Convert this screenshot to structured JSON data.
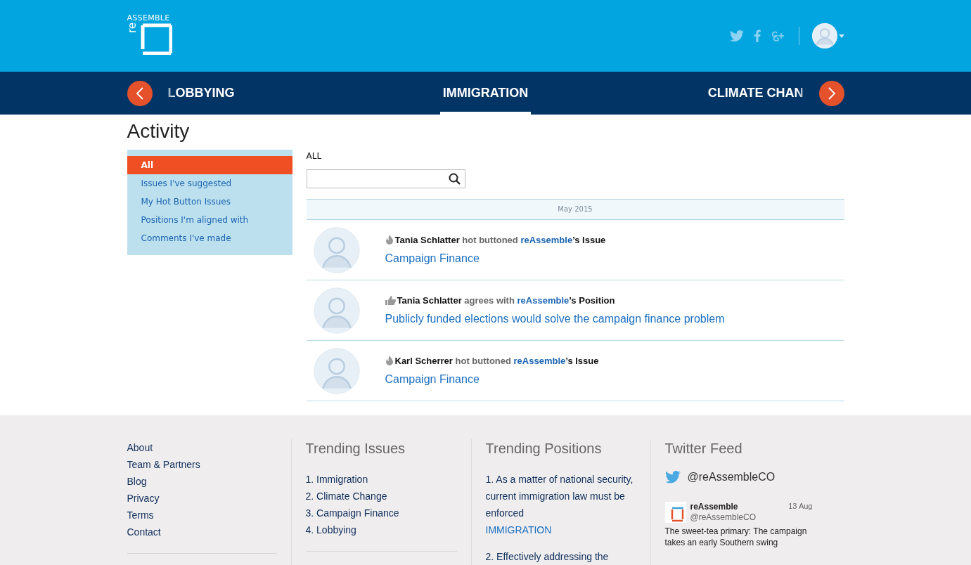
{
  "header": {
    "logo": {
      "top": "ASSEMBLE",
      "side": "re"
    },
    "social": [
      {
        "kind": "twitter"
      },
      {
        "kind": "facebook"
      },
      {
        "kind": "google-plus"
      }
    ]
  },
  "topic_nav": {
    "topics": [
      {
        "label": "LOBBYING",
        "selected": false
      },
      {
        "label": "IMMIGRATION",
        "selected": true
      },
      {
        "label": "CLIMATE CHAN",
        "selected": false
      }
    ]
  },
  "page_title": "Activity",
  "filters": [
    {
      "label": "All",
      "selected": true
    },
    {
      "label": "Issues I've suggested",
      "selected": false
    },
    {
      "label": "My Hot Button Issues",
      "selected": false
    },
    {
      "label": "Positions I'm aligned with",
      "selected": false
    },
    {
      "label": "Comments I've made",
      "selected": false
    }
  ],
  "feed": {
    "heading": "ALL",
    "month": "May 2015",
    "items": [
      {
        "kind": "hot",
        "actor": "Tania Schlatter",
        "verb": "hot buttoned",
        "owner": "reAssemble",
        "suffix": "’s Issue",
        "title": "Campaign Finance"
      },
      {
        "kind": "agree",
        "actor": "Tania Schlatter",
        "verb": "agrees with",
        "owner": "reAssemble",
        "suffix": "’s Position",
        "title": "Publicly funded elections would solve the campaign finance problem"
      },
      {
        "kind": "hot",
        "actor": "Karl Scherrer",
        "verb": "hot buttoned",
        "owner": "reAssemble",
        "suffix": "’s Issue",
        "title": "Campaign Finance"
      }
    ]
  },
  "footer": {
    "links": [
      "About",
      "Team & Partners",
      "Blog",
      "Privacy",
      "Terms",
      "Contact"
    ],
    "trending_issues": {
      "title": "Trending Issues",
      "items": [
        "1. Immigration",
        "2. Climate Change",
        "3. Campaign Finance",
        "4. Lobbying"
      ]
    },
    "trending_positions": {
      "title": "Trending Positions",
      "items": [
        {
          "text": "1. As a matter of national security, current immigration law must be enforced",
          "tag": "IMMIGRATION"
        },
        {
          "text": "2. Effectively addressing the"
        }
      ]
    },
    "twitter": {
      "title": "Twitter Feed",
      "handle": "@reAssembleCO",
      "tweet": {
        "name": "reAssemble",
        "handle": "@reAssembleCO",
        "date": "13 Aug",
        "text": "The sweet-tea primary: The campaign takes an early Southern swing"
      }
    }
  }
}
